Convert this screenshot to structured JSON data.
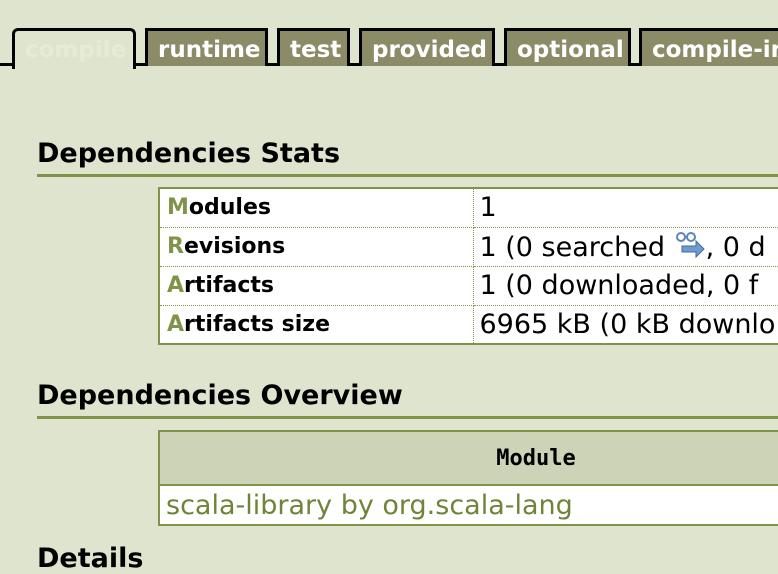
{
  "tabs": [
    {
      "label": "compile",
      "active": true
    },
    {
      "label": "runtime",
      "active": false
    },
    {
      "label": "test",
      "active": false
    },
    {
      "label": "provided",
      "active": false
    },
    {
      "label": "optional",
      "active": false
    },
    {
      "label": "compile-in",
      "active": false
    }
  ],
  "stats": {
    "title": "Dependencies Stats",
    "rows": [
      {
        "first": "M",
        "rest": "odules",
        "value": "1"
      },
      {
        "first": "R",
        "rest": "evisions",
        "value_pre": "1 (0 searched ",
        "value_post": ", 0 d"
      },
      {
        "first": "A",
        "rest": "rtifacts",
        "value": "1 (0 downloaded, 0 f"
      },
      {
        "first": "A",
        "rest": "rtifacts size",
        "value": "6965 kB (0 kB downlo"
      }
    ]
  },
  "overview": {
    "title": "Dependencies Overview",
    "column_header": "Module",
    "rows": [
      {
        "module": "scala-library by org.scala-lang"
      }
    ]
  },
  "details": {
    "title": "Details"
  },
  "colors": {
    "background": "#dfe4cf",
    "accent": "#7f9448",
    "tab_inactive": "#8b8c67",
    "header_cell": "#ccd3b7"
  },
  "icons": {
    "searched": "searched-icon"
  }
}
